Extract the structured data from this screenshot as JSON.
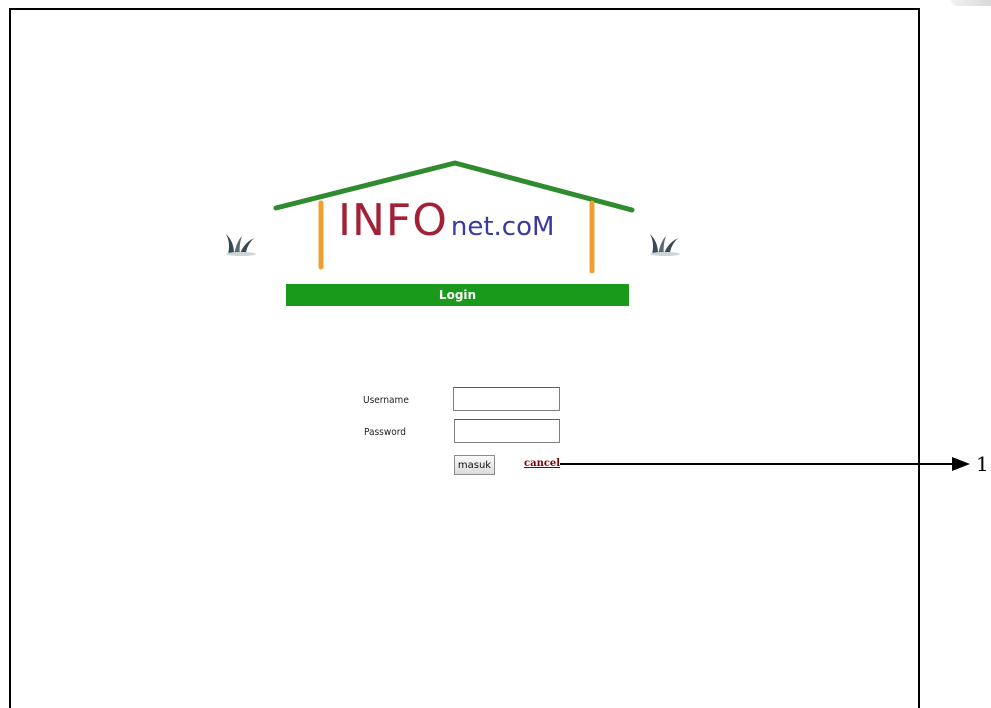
{
  "logo": {
    "name_main": "INFO",
    "name_suffix": "net.coM"
  },
  "login_header": "Login",
  "form": {
    "username_label": "Username",
    "password_label": "Password",
    "username_value": "",
    "password_value": "",
    "submit_label": "masuk",
    "cancel_label": "cancel"
  },
  "annotation": {
    "number": "1"
  },
  "colors": {
    "roof": "#2e8b2e",
    "pillar": "#f0a030",
    "login_bar": "#1a9a1a",
    "logo_info": "#a32035",
    "logo_net": "#3a3aa0",
    "cancel_link": "#7a0000"
  },
  "icons": [
    "grass-left-icon",
    "grass-right-icon",
    "arrow-right-icon"
  ]
}
